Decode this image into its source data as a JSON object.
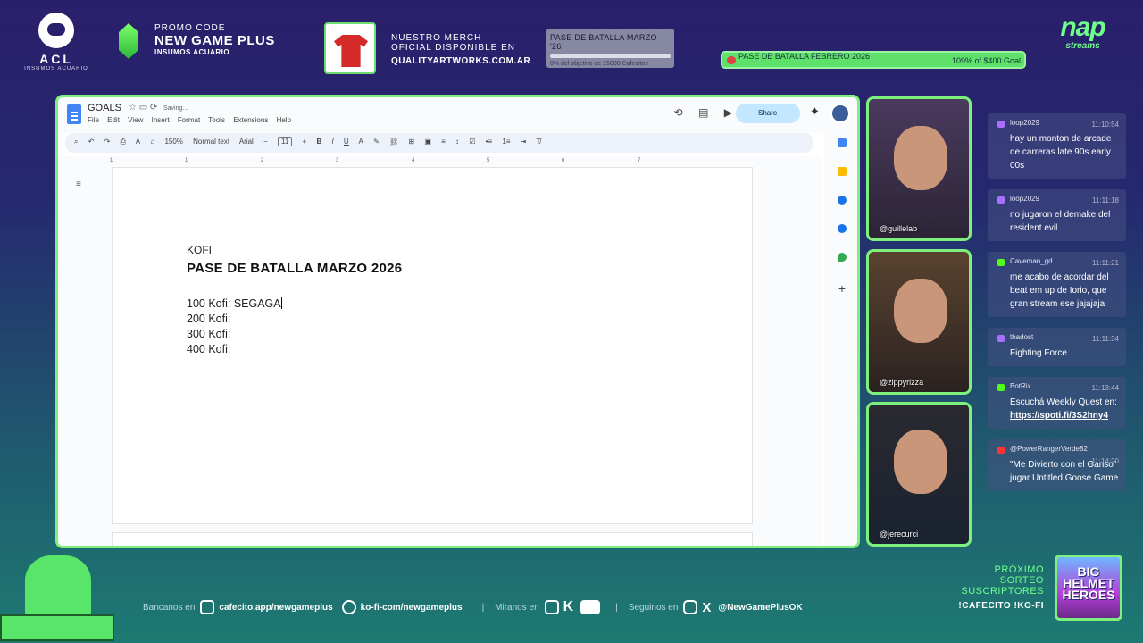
{
  "top": {
    "acl_logo": "ACL",
    "acl_sub": "INSUMOS ACUARIO",
    "promo_label": "PROMO CODE",
    "promo_code": "NEW GAME PLUS",
    "promo_sub": "INSUMOS ACUARIO",
    "merch_line1": "NUESTRO MERCH",
    "merch_line2": "OFICIAL DISPONIBLE EN",
    "merch_url": "QUALITYARTWORKS.COM.AR",
    "goal_title": "PASE DE BATALLA MARZO '26",
    "goal_progress": 0,
    "goal_sub": "0% del objetivo de 15000 Cafecitos",
    "kofi_title": "PASE DE BATALLA FEBRERO 2026",
    "kofi_right": "109% of $400 Goal",
    "nap_logo": "nap",
    "nap_sub": "streams"
  },
  "doc": {
    "title": "GOALS",
    "saving": "Saving...",
    "menus": [
      "File",
      "Edit",
      "View",
      "Insert",
      "Format",
      "Tools",
      "Extensions",
      "Help"
    ],
    "share": "Share",
    "zoom": "150%",
    "style": "Normal text",
    "font": "Arial",
    "font_size": "11",
    "ruler": [
      "1",
      "1",
      "2",
      "3",
      "4",
      "5",
      "6",
      "7"
    ],
    "kofi_label": "KOFI",
    "page_title": "PASE DE BATALLA MARZO 2026",
    "lines": [
      "100 Kofi: SEGAGA",
      "200 Kofi:",
      "300 Kofi:",
      "400 Kofi:"
    ]
  },
  "cams": [
    "@guillelab",
    "@zippyrizza",
    "@jerecurci"
  ],
  "chat": [
    {
      "platform": "twitch",
      "user": "loop2029",
      "time": "11:10:54",
      "text": "hay un monton de arcade de carreras late 90s early 00s",
      "color": "#a970ff"
    },
    {
      "platform": "twitch",
      "user": "loop2029",
      "time": "11:11:18",
      "text": "no jugaron el demake del resident evil",
      "color": "#a970ff"
    },
    {
      "platform": "kick",
      "user": "Caveman_gd",
      "time": "11:11:21",
      "text": "me acabo de acordar del beat em up de Iorio, que gran stream ese jajajaja",
      "color": "#53fc18"
    },
    {
      "platform": "twitch",
      "user": "thadost",
      "time": "11:11:34",
      "text": "Fighting Force",
      "color": "#a970ff"
    },
    {
      "platform": "kick",
      "user": "BotRix",
      "time": "11:13:44",
      "text": "Escuchá Weekly Quest en:",
      "link": "https://spoti.fi/3S2hny4",
      "color": "#53fc18"
    },
    {
      "platform": "youtube",
      "user": "@PowerRangerVerde82",
      "time": "11:14:20",
      "text": "\"Me Divierto con el Ganso\" jugar Untitled Goose Game",
      "color": "#ff3333"
    }
  ],
  "bottom": {
    "bancanos": "Bancanos en",
    "cafecito": "cafecito.app/newgameplus",
    "kofi": "ko-fi-com/newgameplus",
    "miranos": "Miranos en",
    "seguinos": "Seguinos en",
    "handle": "@NewGamePlusOK",
    "sorteo1": "PRÓXIMO",
    "sorteo2": "SORTEO",
    "sorteo3": "SUSCRIPTORES",
    "sorteo_cmd": "!CAFECITO !KO-FI",
    "game_title": "BIG HELMET HEROES"
  }
}
